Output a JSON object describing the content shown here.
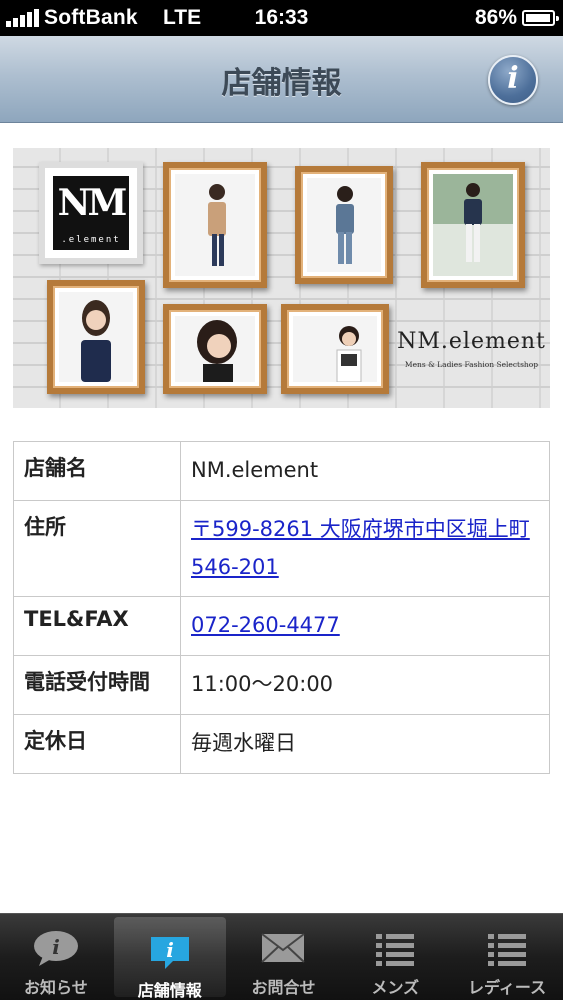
{
  "status_bar": {
    "carrier": "SoftBank",
    "network": "LTE",
    "time": "16:33",
    "battery": "86%",
    "battery_level": 0.86
  },
  "nav": {
    "title": "店舗情報",
    "info_icon": "info-icon"
  },
  "banner": {
    "logo_mark": "NM",
    "logo_sub": ".element",
    "brand_name": "NM.element",
    "brand_tagline": "Mens & Ladies Fashion Selectshop"
  },
  "store": {
    "rows": [
      {
        "label": "店舗名",
        "value": "NM.element"
      },
      {
        "label": "住所",
        "value": "〒599-8261 大阪府堺市中区堀上町546-201"
      },
      {
        "label": "TEL&FAX",
        "value": "072-260-4477"
      },
      {
        "label": "電話受付時間",
        "value": "11:00〜20:00"
      },
      {
        "label": "定休日",
        "value": "毎週水曜日"
      }
    ]
  },
  "tabs": [
    {
      "label": "お知らせ",
      "icon": "speech-bubble-icon"
    },
    {
      "label": "店舗情報",
      "icon": "info-icon",
      "active": true
    },
    {
      "label": "お問合せ",
      "icon": "envelope-icon"
    },
    {
      "label": "メンズ",
      "icon": "list-icon"
    },
    {
      "label": "レディース",
      "icon": "list-icon"
    }
  ]
}
